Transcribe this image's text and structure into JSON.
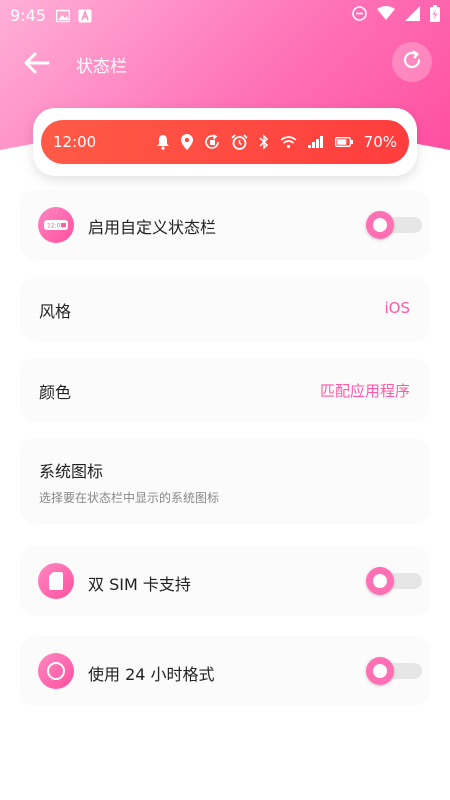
{
  "system_bar": {
    "time": "9:45",
    "icons": [
      "image-icon",
      "a-icon",
      "dnd-icon",
      "wifi-icon",
      "signal-icon",
      "battery-charging-icon"
    ]
  },
  "appbar": {
    "title": "状态栏",
    "back_icon": "arrow-left-icon",
    "reset_icon": "refresh-icon"
  },
  "preview": {
    "time": "12:00",
    "battery": "70%",
    "icons": [
      "bell-icon",
      "location-icon",
      "rotate-icon",
      "alarm-icon",
      "bluetooth-icon",
      "wifi-icon",
      "signal-icon",
      "battery-icon"
    ],
    "bar_color": "#ff4a42"
  },
  "settings": {
    "enable_custom": {
      "label": "启用自定义状态栏",
      "enabled": false
    },
    "style": {
      "label": "风格",
      "value": "iOS"
    },
    "color": {
      "label": "颜色",
      "value": "匹配应用程序"
    },
    "system_icons": {
      "label": "系统图标",
      "subtitle": "选择要在状态栏中显示的系统图标"
    },
    "dual_sim": {
      "label": "双 SIM 卡支持",
      "enabled": false
    },
    "hour24": {
      "label": "使用 24 小时格式",
      "enabled": false
    }
  },
  "colors": {
    "accent": "#ff5aa8",
    "header_gradient_start": "#ffb0d8",
    "header_gradient_end": "#ff4fa0"
  }
}
